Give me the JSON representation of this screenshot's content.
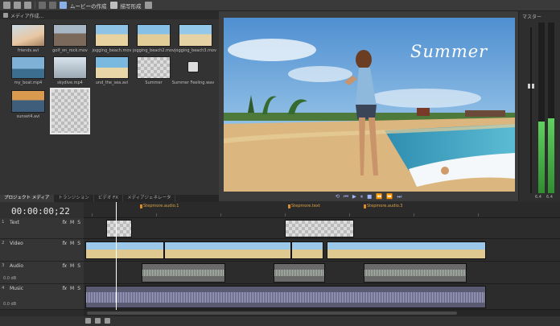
{
  "toolbar": {
    "items": [
      "ムービーの作成",
      "描写形成"
    ]
  },
  "media": {
    "header": "メディア作成...",
    "files": [
      {
        "name": "friends.avi"
      },
      {
        "name": "golf_on_rock.mov"
      },
      {
        "name": "jogging_beach.mov"
      },
      {
        "name": "jogging_beach2.mov"
      },
      {
        "name": "jogging_beach3.mov"
      },
      {
        "name": "my_boat.mp4"
      },
      {
        "name": "skydive.mp4"
      },
      {
        "name": "und_the_sea.avi"
      },
      {
        "name": "Summer"
      },
      {
        "name": "Summer Feeling.wav"
      },
      {
        "name": "sunset4.avi"
      },
      {
        "name": ""
      }
    ]
  },
  "preview": {
    "overlay_text": "Summer"
  },
  "master": {
    "title": "マスター",
    "left_value": "6.4",
    "right_value": "6.4",
    "left_level": 0.42,
    "right_level": 0.44
  },
  "tabs": [
    "プロジェクト メディア",
    "トランジション",
    "ビデオ FX",
    "メディアジェネレータ"
  ],
  "timeline": {
    "timecode": "00:00:00;22",
    "markers": [
      "Stepmore.audio.1",
      "Stepmore.text",
      "Stepmore.audio.3"
    ],
    "tracks": [
      {
        "num": "1",
        "name": "Text",
        "type": "text",
        "vol": ""
      },
      {
        "num": "2",
        "name": "Video",
        "type": "video",
        "vol": ""
      },
      {
        "num": "3",
        "name": "Audio",
        "type": "audio",
        "vol": "0.0 dB"
      },
      {
        "num": "4",
        "name": "Music",
        "type": "music",
        "vol": "0.0 dB"
      }
    ]
  },
  "colors": {
    "accent": "#3b7bd8",
    "marker": "#d98b2a",
    "meter": "#4fbf4f"
  }
}
